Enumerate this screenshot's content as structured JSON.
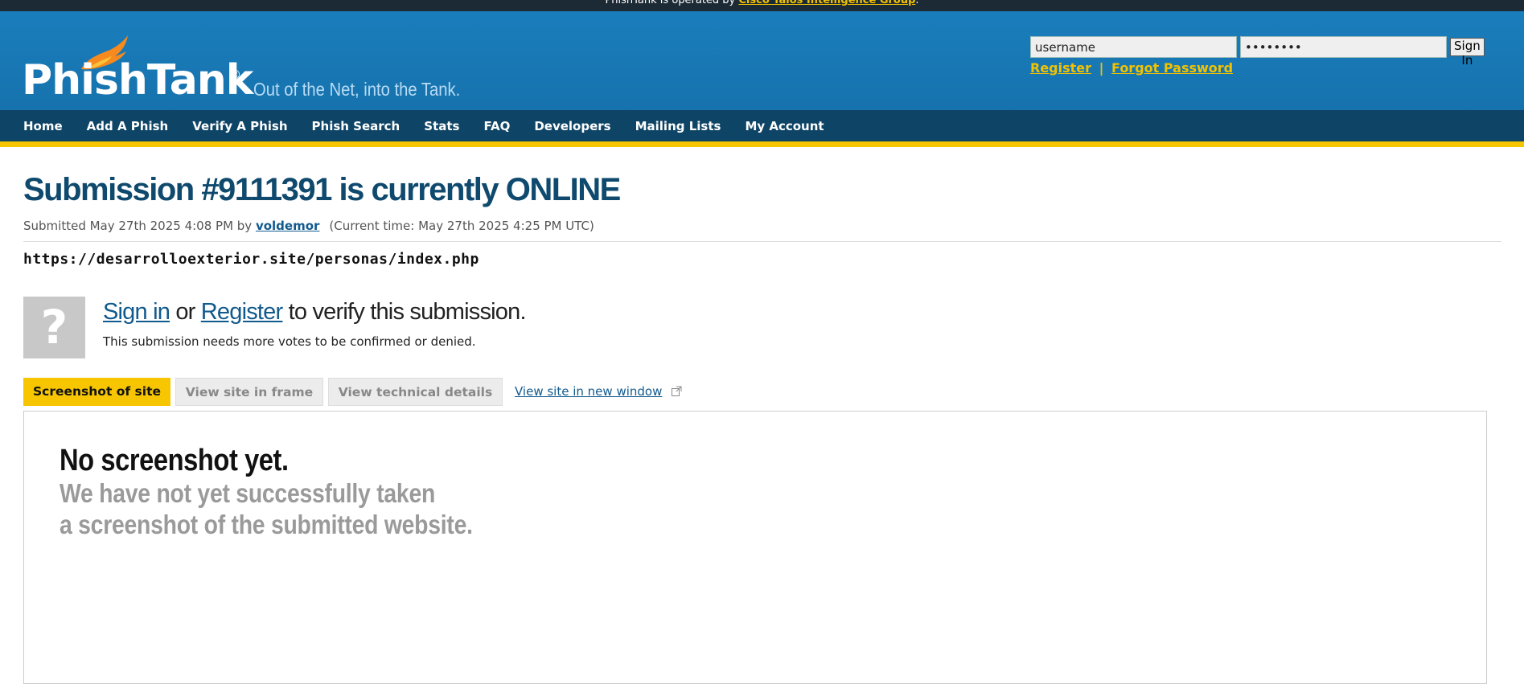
{
  "topbar": {
    "text": "PhishTank is operated by ",
    "link": "Cisco Talos Intelligence Group",
    "suffix": "."
  },
  "logo": {
    "wordmark": "PhishTank",
    "registered": "®",
    "tagline": "Out of the Net, into the Tank."
  },
  "login": {
    "username_value": "username",
    "password_value": "password",
    "signin_label": "Sign In",
    "register_label": "Register",
    "separator": "|",
    "forgot_label": "Forgot Password"
  },
  "nav": {
    "items": [
      "Home",
      "Add A Phish",
      "Verify A Phish",
      "Phish Search",
      "Stats",
      "FAQ",
      "Developers",
      "Mailing Lists",
      "My Account"
    ]
  },
  "submission": {
    "title_bold": "Submission #9111391",
    "title_rest": " is currently ONLINE",
    "submitted_prefix": "Submitted May 27th 2025 4:08 PM by ",
    "submitter": "voldemor",
    "current_time": "(Current time: May 27th 2025 4:25 PM UTC)",
    "url": "https://desarrolloexterior.site/personas/index.php"
  },
  "verify": {
    "icon_glyph": "?",
    "signin_link": "Sign in",
    "or_text": " or ",
    "register_link": "Register",
    "rest_text": " to verify this submission.",
    "subtext": "This submission needs more votes to be confirmed or denied."
  },
  "tabs": {
    "screenshot": "Screenshot of site",
    "frame": "View site in frame",
    "technical": "View technical details",
    "new_window": "View site in new window"
  },
  "screenshot_panel": {
    "heading": "No screenshot yet.",
    "line1": "We have not yet successfully taken",
    "line2": "a screenshot of the submitted website."
  },
  "colors": {
    "header_blue": "#1878b4",
    "nav_dark": "#0e4466",
    "accent_yellow": "#f7c600",
    "title_blue": "#0f4a6e",
    "link_blue": "#115a8e"
  }
}
